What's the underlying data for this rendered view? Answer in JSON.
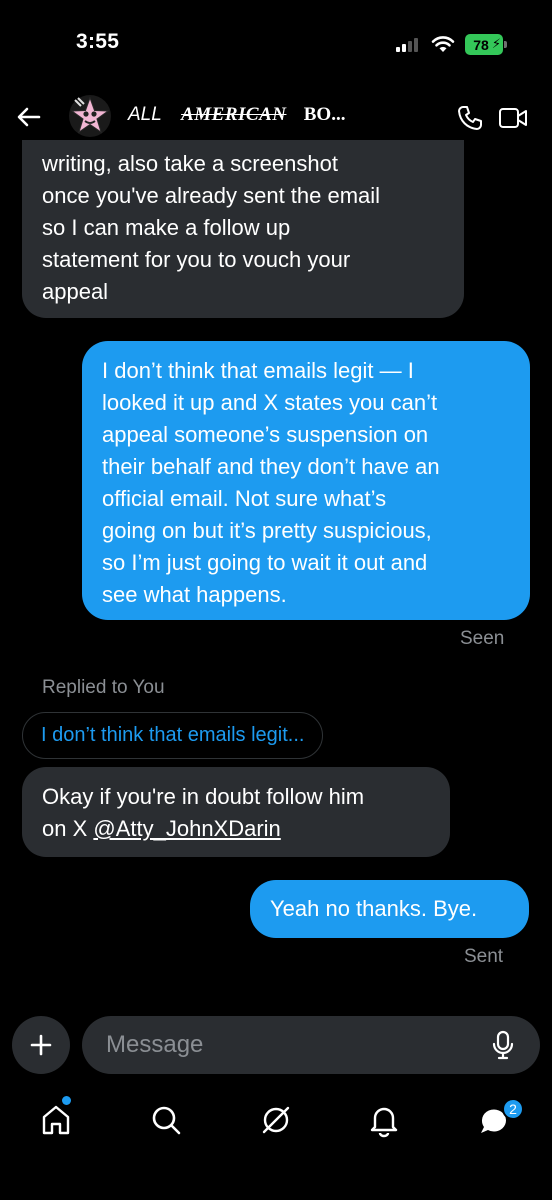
{
  "status_bar": {
    "time": "3:55",
    "battery": "78"
  },
  "header": {
    "title_all": "ALL",
    "title_american": "AMERICAN",
    "title_bo": "BO...",
    "colors": {
      "accent": "#1d9bf0"
    }
  },
  "messages": [
    {
      "direction": "incoming",
      "lines": [
        "writing, also take a screenshot",
        "once you've already sent the email",
        "so I can make a follow up",
        "statement for you to vouch your",
        "appeal"
      ]
    },
    {
      "direction": "outgoing",
      "lines": [
        "I don’t think that emails legit — I",
        "looked it up and X states you can’t",
        "appeal someone’s suspension on",
        "their behalf and they don’t have an",
        "official email. Not sure what’s",
        "going on but it’s pretty suspicious,",
        "so I’m just going to wait it out and",
        "see what happens."
      ],
      "status": "Seen"
    },
    {
      "direction": "incoming",
      "replied_label": "Replied to You",
      "quote": "I don’t think that emails legit...",
      "text_line1": "Okay if you're in doubt follow him",
      "text_line2_prefix": "on X ",
      "mention": "@Atty_JohnXDarin"
    },
    {
      "direction": "outgoing",
      "text": "Yeah no thanks. Bye.",
      "status": "Sent"
    }
  ],
  "composer": {
    "placeholder": "Message"
  },
  "bottom_nav": {
    "items": [
      "home-icon",
      "search-icon",
      "grok-icon",
      "notifications-icon",
      "messages-icon"
    ],
    "messages_badge": "2"
  }
}
